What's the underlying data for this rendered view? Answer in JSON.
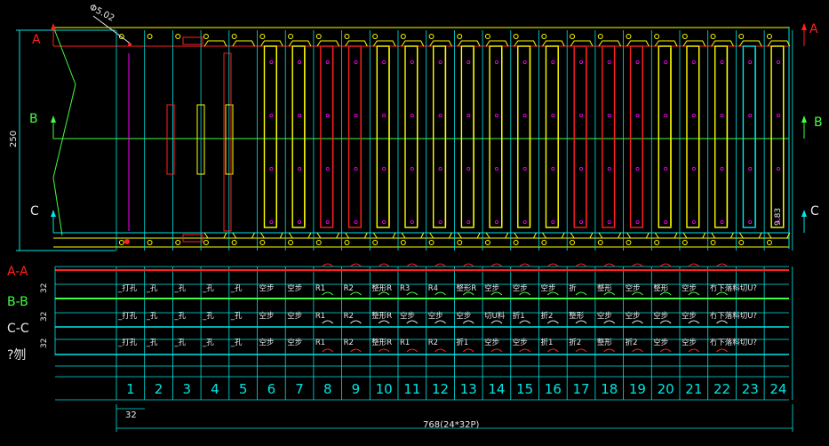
{
  "drawing": {
    "dimensions": {
      "diameter_label": "Φ5.02",
      "height_label": "250",
      "small_label": "9.83",
      "pitch_label": "32",
      "row_pitch_label": "32",
      "total_label": "768(24*32P)"
    },
    "section_markers": {
      "a": "A",
      "b": "B",
      "c": "C"
    },
    "row_labels": {
      "aa": "A-A",
      "bb": "B-B",
      "cc": "C-C",
      "feed": "?刎"
    },
    "rows": {
      "aa": [
        "_打孔",
        "_孔",
        "_孔",
        "_孔",
        "_孔",
        "空步",
        "空步",
        "R1",
        "R2",
        "整形R",
        "R3",
        "R4",
        "整形R",
        "空步",
        "空步",
        "空步",
        "折",
        "整形",
        "空步",
        "整形",
        "空步",
        "冇下落料切U?"
      ],
      "bb": [
        "_打孔",
        "_孔",
        "_孔",
        "_孔",
        "_孔",
        "空步",
        "空步",
        "R1",
        "R2",
        "整形R",
        "空步",
        "空步",
        "空步",
        "切U料",
        "折1",
        "折2",
        "整形",
        "空步",
        "空步",
        "空步",
        "空步",
        "冇下落料切U?"
      ],
      "cc": [
        "_打孔",
        "_孔",
        "_孔",
        "_孔",
        "_孔",
        "空步",
        "空步",
        "R1",
        "R2",
        "整形R",
        "R1",
        "R2",
        "折1",
        "空步",
        "空步",
        "折1",
        "折2",
        "整形",
        "折2",
        "空步",
        "空步",
        "冇下落料切U?"
      ]
    },
    "station_numbers": [
      "1",
      "2",
      "3",
      "4",
      "5",
      "6",
      "7",
      "8",
      "9",
      "10",
      "11",
      "12",
      "13",
      "14",
      "15",
      "16",
      "17",
      "18",
      "19",
      "20",
      "21",
      "22",
      "23",
      "24"
    ],
    "colors": {
      "background": "#000000",
      "cyan": "#00e5e5",
      "yellow": "#ffff00",
      "red": "#ff2020",
      "green": "#40ff40",
      "magenta": "#ff00ff",
      "white": "#e8e8e8"
    }
  }
}
